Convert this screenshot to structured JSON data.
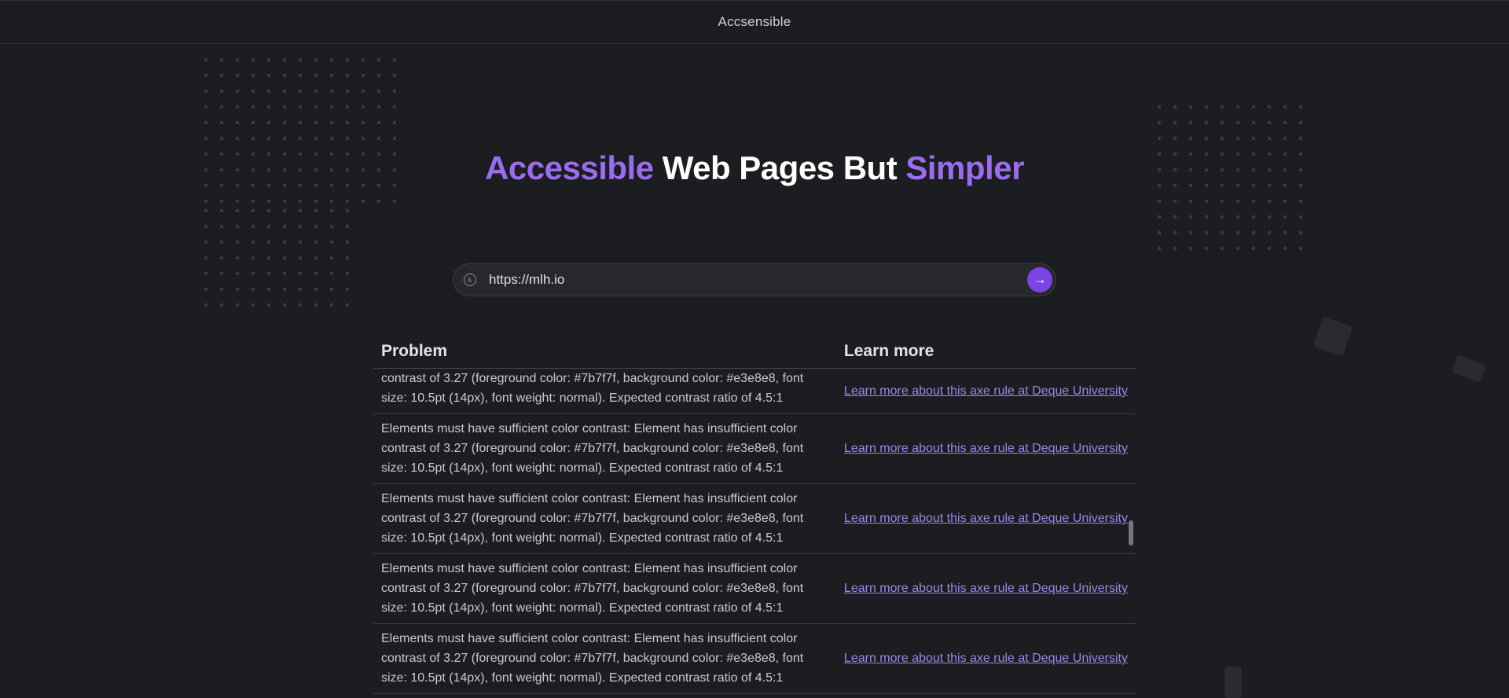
{
  "header": {
    "brand": "Accsensible"
  },
  "hero": {
    "part1": "Accessible",
    "part2": " Web Pages But ",
    "part3": "Simpler"
  },
  "search": {
    "value": "https://mlh.io",
    "icon": "accessibility-icon",
    "button_icon": "arrow-right-icon"
  },
  "colors": {
    "background": "#1c1d21",
    "accent": "#9b6cf0",
    "button": "#7b45e6",
    "link": "#9c86ea"
  },
  "table": {
    "headers": {
      "problem": "Problem",
      "learn": "Learn more"
    },
    "first_row": {
      "problem": "contrast of 3.27 (foreground color: #7b7f7f, background color: #e3e8e8, font size: 10.5pt (14px), font weight: normal). Expected contrast ratio of 4.5:1",
      "link": "Learn more about this axe rule at Deque University"
    },
    "rows": [
      {
        "problem": "Elements must have sufficient color contrast: Element has insufficient color contrast of 3.27 (foreground color: #7b7f7f, background color: #e3e8e8, font size: 10.5pt (14px), font weight: normal). Expected contrast ratio of 4.5:1",
        "link": "Learn more about this axe rule at Deque University"
      },
      {
        "problem": "Elements must have sufficient color contrast: Element has insufficient color contrast of 3.27 (foreground color: #7b7f7f, background color: #e3e8e8, font size: 10.5pt (14px), font weight: normal). Expected contrast ratio of 4.5:1",
        "link": "Learn more about this axe rule at Deque University"
      },
      {
        "problem": "Elements must have sufficient color contrast: Element has insufficient color contrast of 3.27 (foreground color: #7b7f7f, background color: #e3e8e8, font size: 10.5pt (14px), font weight: normal). Expected contrast ratio of 4.5:1",
        "link": "Learn more about this axe rule at Deque University"
      },
      {
        "problem": "Elements must have sufficient color contrast: Element has insufficient color contrast of 3.27 (foreground color: #7b7f7f, background color: #e3e8e8, font size: 10.5pt (14px), font weight: normal). Expected contrast ratio of 4.5:1",
        "link": "Learn more about this axe rule at Deque University"
      }
    ]
  }
}
